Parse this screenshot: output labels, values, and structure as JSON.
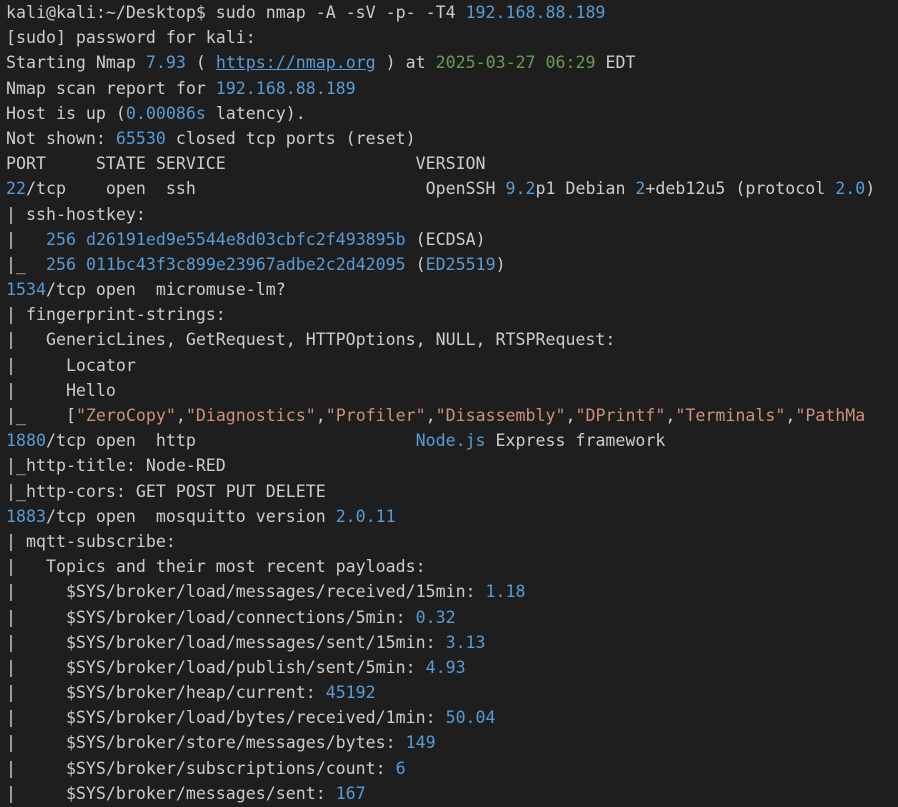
{
  "terminal": {
    "lines": [
      [
        [
          "kali@kali:~/Desktop$ sudo nmap -A -sV -p- -T4 ",
          "text"
        ],
        [
          "192.168.88.189",
          "num"
        ]
      ],
      [
        [
          "[sudo] password for kali:",
          "text"
        ]
      ],
      [
        [
          "Starting Nmap ",
          "text"
        ],
        [
          "7.93",
          "num"
        ],
        [
          " ( ",
          "text"
        ],
        [
          "https://nmap.org",
          "link"
        ],
        [
          " ) at ",
          "text"
        ],
        [
          "2025-03-27 06:29",
          "date"
        ],
        [
          " EDT",
          "text"
        ]
      ],
      [
        [
          "Nmap scan report for ",
          "text"
        ],
        [
          "192.168.88.189",
          "num"
        ]
      ],
      [
        [
          "Host is up (",
          "text"
        ],
        [
          "0.00086s",
          "num"
        ],
        [
          " latency).",
          "text"
        ]
      ],
      [
        [
          "Not shown: ",
          "text"
        ],
        [
          "65530",
          "num"
        ],
        [
          " closed tcp ports (reset)",
          "text"
        ]
      ],
      [
        [
          "PORT     STATE SERVICE                   VERSION",
          "text"
        ]
      ],
      [
        [
          "22",
          "num"
        ],
        [
          "/tcp    open  ssh                       OpenSSH ",
          "text"
        ],
        [
          "9.2",
          "num"
        ],
        [
          "p1 Debian ",
          "text"
        ],
        [
          "2",
          "num"
        ],
        [
          "+deb12u5 (protocol ",
          "text"
        ],
        [
          "2.0",
          "num"
        ],
        [
          ")",
          "text"
        ]
      ],
      [
        [
          "| ssh-hostkey:",
          "text"
        ]
      ],
      [
        [
          "|   ",
          "text"
        ],
        [
          "256",
          "num"
        ],
        [
          " ",
          "text"
        ],
        [
          "d26191ed9e5544e8d03cbfc2f493895b",
          "num"
        ],
        [
          " (ECDSA)",
          "text"
        ]
      ],
      [
        [
          "|_  ",
          "text"
        ],
        [
          "256",
          "num"
        ],
        [
          " ",
          "text"
        ],
        [
          "011bc43f3c899e23967adbe2c2d42095",
          "num"
        ],
        [
          " (",
          "text"
        ],
        [
          "ED25519",
          "num"
        ],
        [
          ")",
          "text"
        ]
      ],
      [
        [
          "1534",
          "num"
        ],
        [
          "/tcp open  micromuse-lm?",
          "text"
        ]
      ],
      [
        [
          "| fingerprint-strings:",
          "text"
        ]
      ],
      [
        [
          "|   GenericLines, GetRequest, HTTPOptions, NULL, RTSPRequest:",
          "text"
        ]
      ],
      [
        [
          "|     Locator",
          "text"
        ]
      ],
      [
        [
          "|     Hello",
          "text"
        ]
      ],
      [
        [
          "|_    [",
          "text"
        ],
        [
          "\"ZeroCopy\"",
          "str"
        ],
        [
          ",",
          "text"
        ],
        [
          "\"Diagnostics\"",
          "str"
        ],
        [
          ",",
          "text"
        ],
        [
          "\"Profiler\"",
          "str"
        ],
        [
          ",",
          "text"
        ],
        [
          "\"Disassembly\"",
          "str"
        ],
        [
          ",",
          "text"
        ],
        [
          "\"DPrintf\"",
          "str"
        ],
        [
          ",",
          "text"
        ],
        [
          "\"Terminals\"",
          "str"
        ],
        [
          ",",
          "text"
        ],
        [
          "\"PathMa",
          "str"
        ]
      ],
      [
        [
          "1880",
          "num"
        ],
        [
          "/tcp open  http                      ",
          "text"
        ],
        [
          "Node.js",
          "num"
        ],
        [
          " Express framework",
          "text"
        ]
      ],
      [
        [
          "|_http-title: Node-RED",
          "text"
        ]
      ],
      [
        [
          "|_http-cors: GET POST PUT DELETE",
          "text"
        ]
      ],
      [
        [
          "1883",
          "num"
        ],
        [
          "/tcp open  mosquitto version ",
          "text"
        ],
        [
          "2.0.11",
          "num"
        ]
      ],
      [
        [
          "| mqtt-subscribe:",
          "text"
        ]
      ],
      [
        [
          "|   Topics and their most recent payloads:",
          "text"
        ]
      ],
      [
        [
          "|     $SYS/broker/load/messages/received/15min: ",
          "text"
        ],
        [
          "1.18",
          "num"
        ]
      ],
      [
        [
          "|     $SYS/broker/load/connections/5min: ",
          "text"
        ],
        [
          "0.32",
          "num"
        ]
      ],
      [
        [
          "|     $SYS/broker/load/messages/sent/15min: ",
          "text"
        ],
        [
          "3.13",
          "num"
        ]
      ],
      [
        [
          "|     $SYS/broker/load/publish/sent/5min: ",
          "text"
        ],
        [
          "4.93",
          "num"
        ]
      ],
      [
        [
          "|     $SYS/broker/heap/current: ",
          "text"
        ],
        [
          "45192",
          "num"
        ]
      ],
      [
        [
          "|     $SYS/broker/load/bytes/received/1min: ",
          "text"
        ],
        [
          "50.04",
          "num"
        ]
      ],
      [
        [
          "|     $SYS/broker/store/messages/bytes: ",
          "text"
        ],
        [
          "149",
          "num"
        ]
      ],
      [
        [
          "|     $SYS/broker/subscriptions/count: ",
          "text"
        ],
        [
          "6",
          "num"
        ]
      ],
      [
        [
          "|     $SYS/broker/messages/sent: ",
          "text"
        ],
        [
          "167",
          "num"
        ]
      ]
    ]
  },
  "colors": {
    "background": "#1e1e1e",
    "text": "#cccccc",
    "num": "#569cd6",
    "str": "#ce9178",
    "date": "#6a9955",
    "link": "#569cd6"
  }
}
